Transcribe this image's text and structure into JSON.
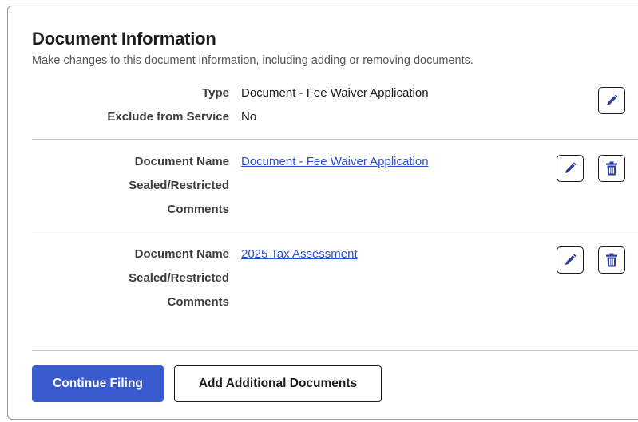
{
  "header": {
    "title": "Document Information",
    "subtitle": "Make changes to this document information, including adding or removing documents."
  },
  "filing_info": {
    "type_label": "Type",
    "type_value": "Document - Fee Waiver Application",
    "exclude_label": "Exclude from Service",
    "exclude_value": "No",
    "edit_icon": "pencil-icon"
  },
  "documents": [
    {
      "name_label": "Document Name",
      "name_value": "Document - Fee Waiver Application",
      "sealed_label": "Sealed/Restricted",
      "comments_label": "Comments",
      "edit_icon": "pencil-icon",
      "delete_icon": "trash-icon"
    },
    {
      "name_label": "Document Name",
      "name_value": "2025 Tax Assessment",
      "sealed_label": "Sealed/Restricted",
      "comments_label": "Comments",
      "edit_icon": "pencil-icon",
      "delete_icon": "trash-icon"
    }
  ],
  "actions": {
    "continue_label": "Continue Filing",
    "add_label": "Add Additional Documents"
  },
  "colors": {
    "accent": "#3a5bd0",
    "link": "#2a4fd6",
    "icon": "#2b3e9e"
  }
}
